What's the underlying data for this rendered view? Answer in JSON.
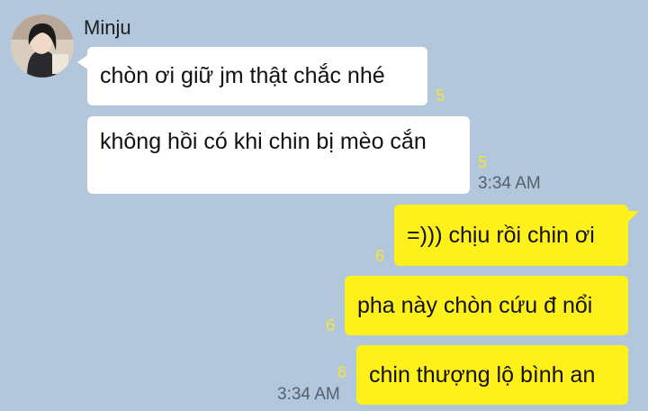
{
  "chat": {
    "incoming": {
      "sender": "Minju",
      "messages": [
        {
          "text": "chòn ơi giữ jm thật chắc nhé",
          "unread": "5"
        },
        {
          "text": "không hồi có khi chin bị mèo cắn",
          "unread": "5"
        }
      ],
      "time": "3:34 AM"
    },
    "outgoing": {
      "messages": [
        {
          "text": "=))) chịu rồi chin ơi",
          "unread": "6"
        },
        {
          "text": "pha này chòn cứu đ nổi",
          "unread": "6"
        },
        {
          "text": "chin thượng lộ bình an",
          "unread": "6"
        }
      ],
      "time": "3:34 AM"
    }
  },
  "colors": {
    "background": "#b3c7dc",
    "incoming_bubble": "#ffffff",
    "outgoing_bubble": "#fef01b",
    "unread_count": "#f5e33a",
    "timestamp": "#55606d"
  }
}
